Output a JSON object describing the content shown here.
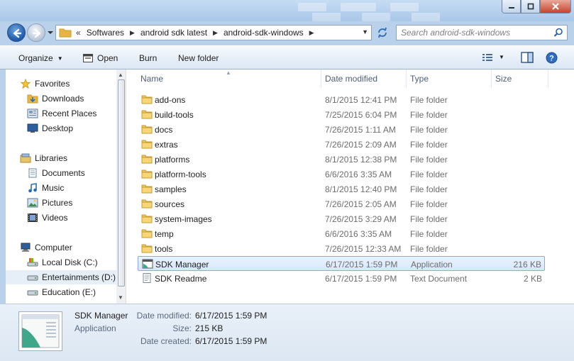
{
  "window": {
    "controls": [
      "minimize",
      "maximize",
      "close"
    ]
  },
  "address": {
    "overflow": "«",
    "crumbs": [
      "Softwares",
      "android sdk latest",
      "android-sdk-windows"
    ]
  },
  "search": {
    "placeholder": "Search android-sdk-windows"
  },
  "toolbar": {
    "organize": "Organize",
    "open": "Open",
    "burn": "Burn",
    "new_folder": "New folder"
  },
  "nav": {
    "favorites": "Favorites",
    "downloads": "Downloads",
    "recent_places": "Recent Places",
    "desktop": "Desktop",
    "libraries": "Libraries",
    "documents": "Documents",
    "music": "Music",
    "pictures": "Pictures",
    "videos": "Videos",
    "computer": "Computer",
    "local_disk": "Local Disk (C:)",
    "entertainments": "Entertainments (D:)",
    "education": "Education (E:)"
  },
  "columns": {
    "name": "Name",
    "date": "Date modified",
    "type": "Type",
    "size": "Size"
  },
  "files": [
    {
      "name": "add-ons",
      "date": "8/1/2015 12:41 PM",
      "type": "File folder",
      "size": "",
      "icon": "folder-icon"
    },
    {
      "name": "build-tools",
      "date": "7/25/2015 6:04 PM",
      "type": "File folder",
      "size": "",
      "icon": "folder-icon"
    },
    {
      "name": "docs",
      "date": "7/26/2015 1:11 AM",
      "type": "File folder",
      "size": "",
      "icon": "folder-icon"
    },
    {
      "name": "extras",
      "date": "7/26/2015 2:09 AM",
      "type": "File folder",
      "size": "",
      "icon": "folder-icon"
    },
    {
      "name": "platforms",
      "date": "8/1/2015 12:38 PM",
      "type": "File folder",
      "size": "",
      "icon": "folder-icon"
    },
    {
      "name": "platform-tools",
      "date": "6/6/2016 3:35 AM",
      "type": "File folder",
      "size": "",
      "icon": "folder-icon"
    },
    {
      "name": "samples",
      "date": "8/1/2015 12:40 PM",
      "type": "File folder",
      "size": "",
      "icon": "folder-icon"
    },
    {
      "name": "sources",
      "date": "7/26/2015 2:05 AM",
      "type": "File folder",
      "size": "",
      "icon": "folder-icon"
    },
    {
      "name": "system-images",
      "date": "7/26/2015 3:29 AM",
      "type": "File folder",
      "size": "",
      "icon": "folder-icon"
    },
    {
      "name": "temp",
      "date": "6/6/2016 3:35 AM",
      "type": "File folder",
      "size": "",
      "icon": "folder-icon"
    },
    {
      "name": "tools",
      "date": "7/26/2015 12:33 AM",
      "type": "File folder",
      "size": "",
      "icon": "folder-icon"
    },
    {
      "name": "SDK Manager",
      "date": "6/17/2015 1:59 PM",
      "type": "Application",
      "size": "216 KB",
      "icon": "application-icon"
    },
    {
      "name": "SDK Readme",
      "date": "6/17/2015 1:59 PM",
      "type": "Text Document",
      "size": "2 KB",
      "icon": "text-document-icon"
    }
  ],
  "details": {
    "name": "SDK Manager",
    "type": "Application",
    "modified_label": "Date modified:",
    "modified": "6/17/2015 1:59 PM",
    "size_label": "Size:",
    "size": "215 KB",
    "created_label": "Date created:",
    "created": "6/17/2015 1:59 PM"
  },
  "colors": {
    "selection_border": "#84acdd",
    "selection_fill": "#d6e8fb",
    "chrome": "#b9d1ea"
  }
}
